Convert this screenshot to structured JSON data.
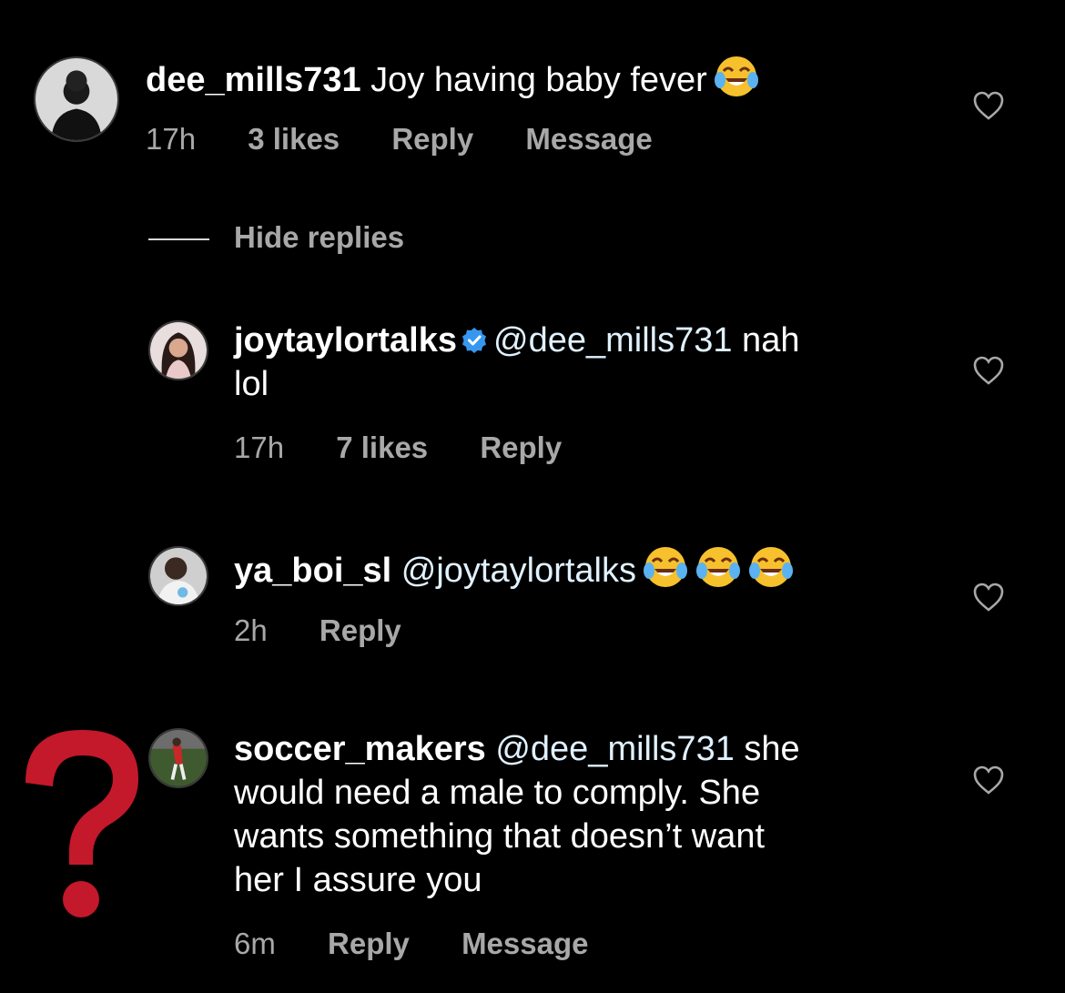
{
  "comments": [
    {
      "username": "dee_mills731",
      "text": "Joy having baby fever",
      "emojis": 1,
      "time": "17h",
      "likes": "3 likes",
      "reply": "Reply",
      "message": "Message"
    }
  ],
  "hide_replies": "Hide replies",
  "replies": [
    {
      "username": "joytaylortalks",
      "verified": true,
      "mention": "@dee_mills731",
      "text_line1": " nah",
      "text_line2": "lol",
      "time": "17h",
      "likes": "7 likes",
      "reply": "Reply"
    },
    {
      "username": "ya_boi_sl",
      "mention": "@joytaylortalks",
      "emojis": 3,
      "time": "2h",
      "reply": "Reply"
    },
    {
      "username": "soccer_makers",
      "mention": "@dee_mills731",
      "text_line1": " she",
      "text_line2": "would need a male to comply. She",
      "text_line3": "wants something that doesn’t want",
      "text_line4": "her I assure you",
      "time": "6m",
      "reply": "Reply",
      "message": "Message"
    }
  ],
  "icons": {
    "heart": "heart-outline-icon",
    "emoji": "tears-of-joy-emoji",
    "verified": "verified-badge-icon",
    "overlay": "question-mark"
  },
  "colors": {
    "background": "#000000",
    "meta": "#a8a8a8",
    "mention": "#e0f1ff",
    "verified": "#3797f0",
    "question_mark": "#c4182b"
  }
}
